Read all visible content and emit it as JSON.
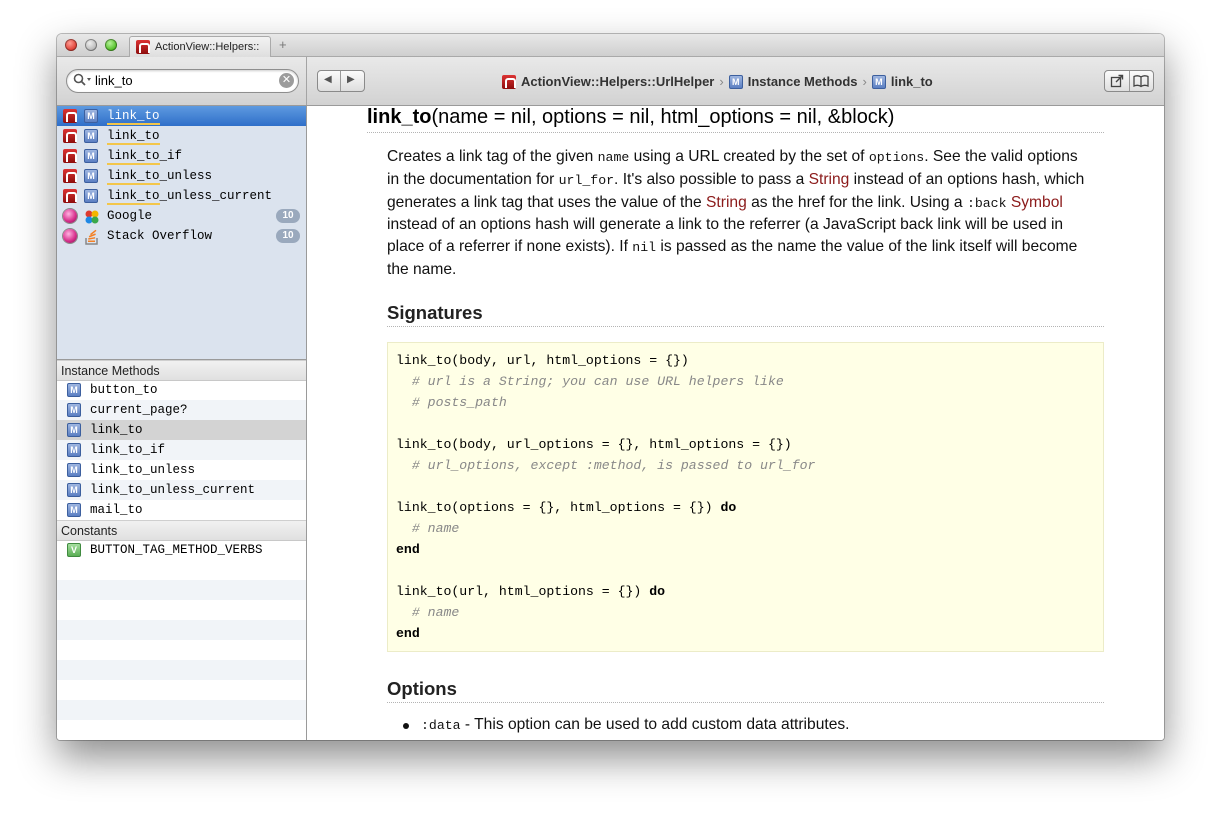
{
  "window": {
    "tab_title": "ActionView::Helpers::",
    "new_tab": "+"
  },
  "toolbar": {
    "search_value": "link_to",
    "back": "◀",
    "forward": "▶",
    "breadcrumb": [
      "ActionView::Helpers::UrlHelper",
      "Instance Methods",
      "link_to"
    ],
    "breadcrumb_sep": "›"
  },
  "sidebar": {
    "results": [
      {
        "icon1": "rails-icon",
        "icon2": "M",
        "label": "link_to",
        "match": "link_to",
        "rest": "",
        "selected": true
      },
      {
        "icon1": "rails-icon",
        "icon2": "M",
        "label": "link_to",
        "match": "link_to",
        "rest": "",
        "selected": false
      },
      {
        "icon1": "rails-icon",
        "icon2": "M",
        "label": "link_to_if",
        "match": "link_to",
        "rest": "_if",
        "selected": false
      },
      {
        "icon1": "rails-icon",
        "icon2": "M",
        "label": "link_to_unless",
        "match": "link_to",
        "rest": "_unless",
        "selected": false
      },
      {
        "icon1": "rails-icon",
        "icon2": "M",
        "label": "link_to_unless_current",
        "match": "link_to",
        "rest": "_unless_current",
        "selected": false
      },
      {
        "icon1": "ball-icon",
        "icon2": "google-icon",
        "label": "Google",
        "match": "",
        "rest": "Google",
        "count": "10"
      },
      {
        "icon1": "ball-icon",
        "icon2": "stackoverflow-icon",
        "label": "Stack Overflow",
        "match": "",
        "rest": "Stack Overflow",
        "count": "10"
      }
    ],
    "instance_methods_header": "Instance Methods",
    "instance_methods": [
      "button_to",
      "current_page?",
      "link_to",
      "link_to_if",
      "link_to_unless",
      "link_to_unless_current",
      "mail_to"
    ],
    "constants_header": "Constants",
    "constants": [
      "BUTTON_TAG_METHOD_VERBS"
    ]
  },
  "doc": {
    "signature_name": "link_to",
    "signature_args": "(name = nil, options = nil, html_options = nil, &block)",
    "para": {
      "t1": "Creates a link tag of the given ",
      "c1": "name",
      "t2": " using a URL created by the set of ",
      "c2": "options",
      "t3": ". See the valid options in the documentation for ",
      "c3": "url_for",
      "t4": ". It's also possible to pass a ",
      "l1": "String",
      "t5": " instead of an options hash, which generates a link tag that uses the value of the ",
      "l2": "String",
      "t6": " as the href for the link. Using a ",
      "c4": ":back",
      "t7": " ",
      "l3": "Symbol",
      "t8": " instead of an options hash will generate a link to the referrer (a JavaScript back link will be used in place of a referrer if none exists). If ",
      "c5": "nil",
      "t9": " is passed as the name the value of the link itself will become the name."
    },
    "signatures_heading": "Signatures",
    "code": {
      "l1": "link_to(body, url, html_options = {})",
      "l2": "  # url is a String; you can use URL helpers like",
      "l3": "  # posts_path",
      "l4": "link_to(body, url_options = {}, html_options = {})",
      "l5": "  # url_options, except :method, is passed to url_for",
      "l6": "link_to(options = {}, html_options = {}) ",
      "kw_do": "do",
      "l7": "  # name",
      "kw_end": "end",
      "l8": "link_to(url, html_options = {}) ",
      "l9": "  # name"
    },
    "options_heading": "Options",
    "option_code": ":data",
    "option_text": " - This option can be used to add custom data attributes."
  }
}
